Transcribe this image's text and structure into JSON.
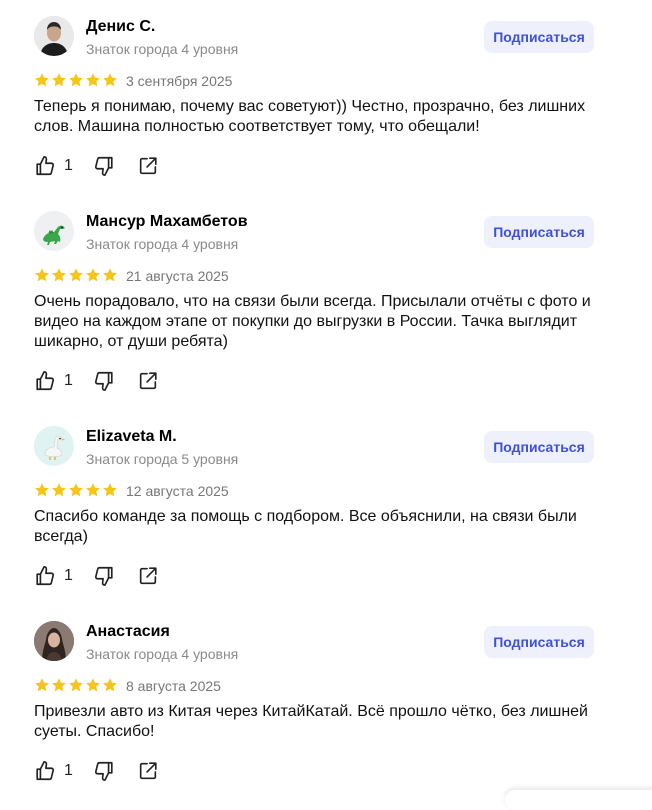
{
  "reviews": [
    {
      "name": "Денис С.",
      "level": "Знаток города 4 уровня",
      "subscribe_label": "Подписаться",
      "rating": 5,
      "date": "3 сентября 2025",
      "text": "Теперь я понимаю, почему вас советуют)) Честно, прозрачно, без лишних слов. Машина полностью соответствует тому, что обещали!",
      "likes": "1",
      "avatar": "man-photo"
    },
    {
      "name": "Мансур Махамбетов",
      "level": "Знаток города 4 уровня",
      "subscribe_label": "Подписаться",
      "rating": 5,
      "date": "21 августа 2025",
      "text": "Очень порадовало, что на связи были всегда. Присылали отчёты с фото и видео на каждом этапе от покупки до выгрузки в России. Тачка выглядит шикарно, от души ребята)",
      "likes": "1",
      "avatar": "dinosaur-icon"
    },
    {
      "name": "Elizaveta M.",
      "level": "Знаток города 5 уровня",
      "subscribe_label": "Подписаться",
      "rating": 5,
      "date": "12 августа 2025",
      "text": "Спасибо команде за помощь с подбором. Все объяснили, на связи были всегда)",
      "likes": "1",
      "avatar": "goose-icon"
    },
    {
      "name": "Анастасия",
      "level": "Знаток города 4 уровня",
      "subscribe_label": "Подписаться",
      "rating": 5,
      "date": "8 августа 2025",
      "text": "Привезли авто из Китая через КитайКатай. Всё прошло чётко, без лишней суеты. Спасибо!",
      "likes": "1",
      "avatar": "woman-photo"
    }
  ],
  "colors": {
    "star": "#f5c518",
    "subscribe_bg": "#eef0fb",
    "subscribe_text": "#3f51d4",
    "level_text": "#8a8a8a"
  },
  "icons": [
    "thumbs-up-icon",
    "thumbs-down-icon",
    "share-icon",
    "star-icon"
  ]
}
